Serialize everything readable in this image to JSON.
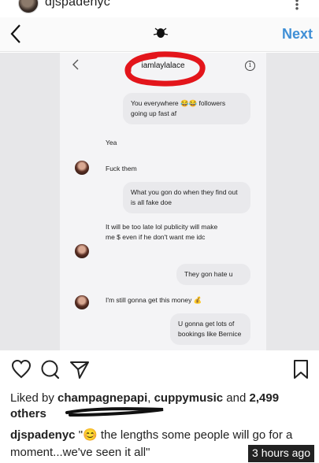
{
  "profile": {
    "username": "djspadenyc",
    "more_icon": "more-vertical-icon"
  },
  "header": {
    "back_icon": "chevron-left-icon",
    "next_label": "Next",
    "center_icon": "bug-icon"
  },
  "dm": {
    "title": "iamlaylalace",
    "info_icon": "i",
    "messages": [
      {
        "side": "out",
        "text": "You everywhere 😂😂 followers going up fast af"
      },
      {
        "side": "in",
        "text": "Yea"
      },
      {
        "side": "in",
        "text": "Fuck them"
      },
      {
        "side": "out",
        "text": "What you gon do when they find out is all fake doe"
      },
      {
        "side": "in",
        "text": "It will be too late lol publicity will make me $ even if he don't want me idc"
      },
      {
        "side": "out",
        "text": "They gon hate u"
      },
      {
        "side": "in",
        "text": "I'm still gonna get this money 💰"
      },
      {
        "side": "out",
        "text": "U gonna get lots of bookings like Bernice"
      }
    ]
  },
  "actions": {
    "like_icon": "heart-icon",
    "comment_icon": "comment-icon",
    "share_icon": "send-icon",
    "save_icon": "bookmark-icon"
  },
  "likes": {
    "prefix": "Liked by ",
    "user1": "champagnepapi",
    "sep1": ", ",
    "user2": "cuppymusic",
    "middle": " and ",
    "count": "2,499",
    "suffix": " others"
  },
  "caption": {
    "username": "djspadenyc",
    "text": " \"😊 the lengths some people will go for a moment...we've seen it all\""
  },
  "timestamp": "3 hours ago",
  "colors": {
    "link_blue": "#3f8fd6",
    "red_marker": "#e3151b",
    "dm_bubble": "#e9e9ec"
  }
}
